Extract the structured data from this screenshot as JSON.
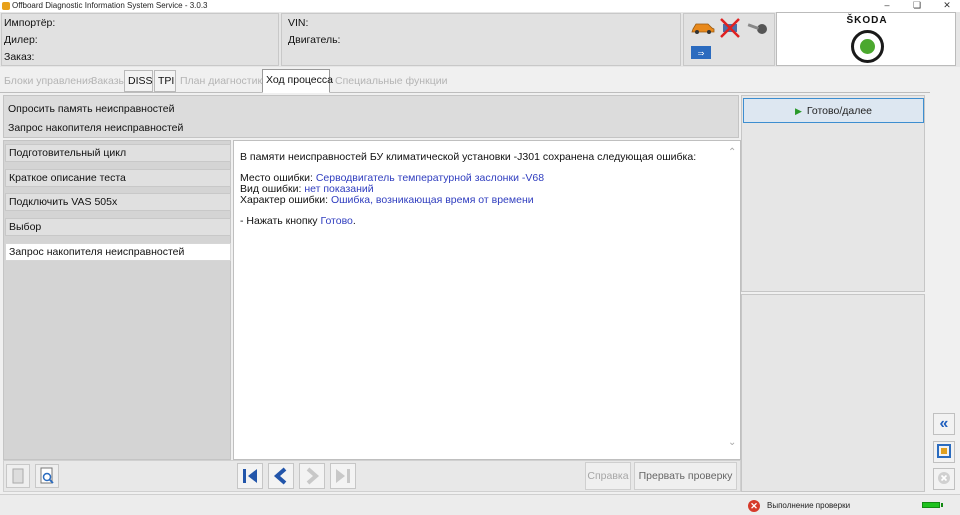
{
  "window": {
    "title": "Offboard Diagnostic Information System Service - 3.0.3",
    "minimize_icon": "minimize-icon",
    "restore_icon": "restore-icon",
    "close_icon": "close-icon"
  },
  "header": {
    "importer_label": "Импортёр:",
    "dealer_label": "Дилер:",
    "order_label": "Заказ:",
    "vin_label": "VIN:",
    "engine_label": "Двигатель:",
    "icons": [
      "car-icon",
      "crossed-vehicle-icon",
      "key-icon",
      "usb-icon"
    ],
    "brand": "ŠKODA"
  },
  "tabs": [
    {
      "label": "Блоки управления",
      "state": "disabled"
    },
    {
      "label": "Заказы",
      "state": "disabled"
    },
    {
      "label": "DISS",
      "state": "enabled"
    },
    {
      "label": "TPI",
      "state": "enabled"
    },
    {
      "label": "План диагностики",
      "state": "disabled"
    },
    {
      "label": "Ход процесса",
      "state": "active"
    },
    {
      "label": "Специальные функции",
      "state": "disabled"
    }
  ],
  "process": {
    "title": "Опросить память неисправностей",
    "subtitle": "Запрос накопителя неисправностей"
  },
  "steps": [
    {
      "label": "Подготовительный цикл"
    },
    {
      "label": "Краткое описание теста"
    },
    {
      "label": "Подключить VAS 505x"
    },
    {
      "label": "Выбор"
    },
    {
      "label": "Запрос накопителя неисправностей",
      "active": true
    }
  ],
  "content": {
    "intro": "В памяти неисправностей БУ климатической установки -J301  сохранена следующая ошибка:",
    "location_label": "Место ошибки: ",
    "location_value": "Серводвигатель температурной заслонки -V68",
    "type_label": "Вид ошибки: ",
    "type_value": "нет показаний",
    "nature_label": "Характер ошибки: ",
    "nature_value": "Ошибка, возникающая время от времени",
    "action_prefix": "- Нажать кнопку ",
    "action_value": "Готово",
    "action_suffix": "."
  },
  "bottombar": {
    "help_label": "Справка",
    "abort_label": "Прервать проверку"
  },
  "right_panel": {
    "ready_label": "Готово/далее"
  },
  "status": {
    "text": "Выполнение проверки"
  },
  "colors": {
    "highlight": "#2f3dbf",
    "active_border": "#3d8ed0",
    "skoda_green": "#4ba82e",
    "error_red": "#d63a2a",
    "battery_green": "#1ec21e"
  }
}
